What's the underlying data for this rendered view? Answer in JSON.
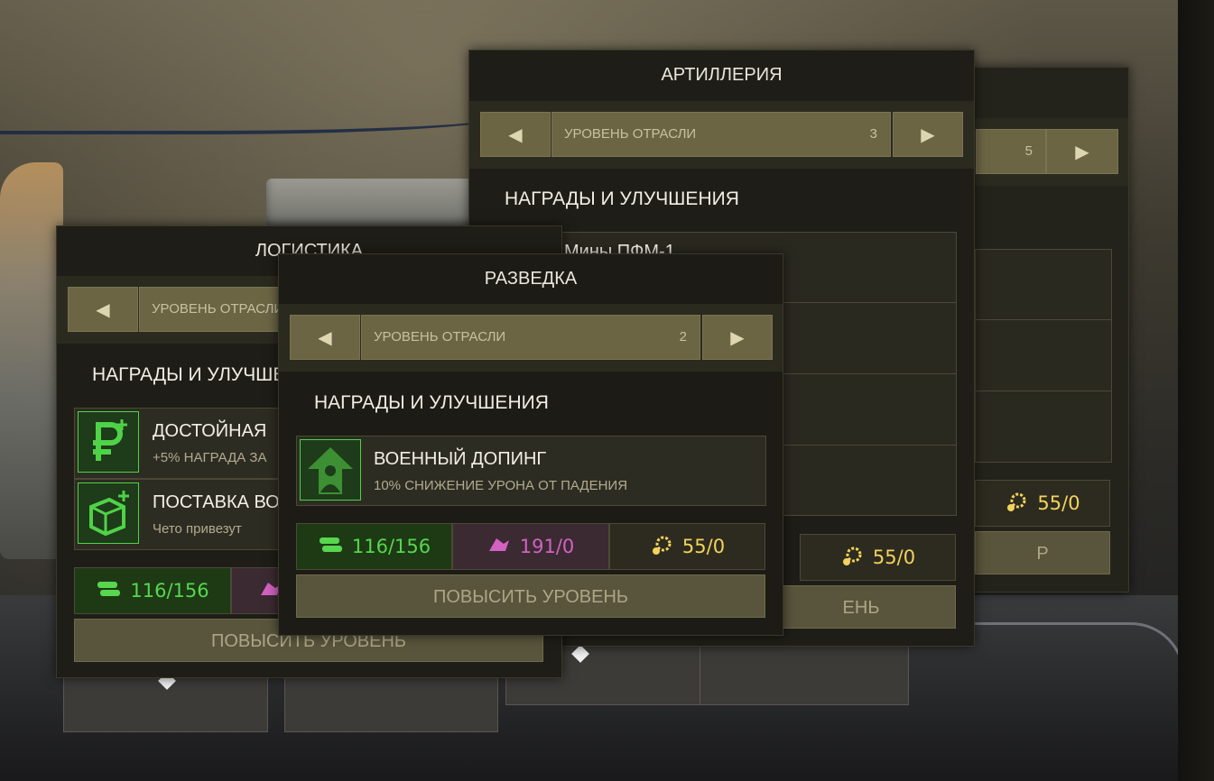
{
  "panels": {
    "back": {
      "level_value": "5",
      "cost_gold": "55/0",
      "upgrade_partial": "Р"
    },
    "artillery": {
      "title": "АРТИЛЛЕРИЯ",
      "level_label": "УРОВЕНЬ ОТРАСЛИ",
      "level_value": "3",
      "section_title": "НАГРАДЫ И УЛУЧШЕНИЯ",
      "reward1_partial": "Мины ПФМ-1",
      "cost_gold": "55/0",
      "upgrade_partial": "ЕНЬ"
    },
    "logistics": {
      "title": "ЛОГИСТИКА",
      "level_label": "УРОВЕНЬ ОТРАСЛИ",
      "section_title": "НАГРАДЫ И УЛУЧШЕНИЯ",
      "rewards": [
        {
          "title": "ДОСТОЙНАЯ",
          "desc": "+5% НАГРАДА ЗА",
          "icon": "ruble-plus-icon"
        },
        {
          "title": "ПОСТАВКА ВО",
          "desc": "Чето привезут",
          "icon": "supply-box-icon"
        }
      ],
      "cost_green": "116/156",
      "upgrade_label": "ПОВЫСИТЬ УРОВЕНЬ"
    },
    "recon": {
      "title": "РАЗВЕДКА",
      "level_label": "УРОВЕНЬ ОТРАСЛИ",
      "level_value": "2",
      "section_title": "НАГРАДЫ И УЛУЧШЕНИЯ",
      "reward": {
        "title": "ВОЕННЫЙ ДОПИНГ",
        "desc": "10% СНИЖЕНИЕ УРОНА ОТ ПАДЕНИЯ",
        "icon": "arrow-up-person-icon"
      },
      "cost_green": "116/156",
      "cost_pink": "191/0",
      "cost_gold": "55/0",
      "upgrade_label": "ПОВЫСИТЬ УРОВЕНЬ"
    }
  },
  "colors": {
    "panel_bg": "#1e1d17",
    "button_bg": "#6b6544",
    "green": "#57d64e",
    "pink": "#d262c2",
    "gold": "#f2d35c"
  }
}
